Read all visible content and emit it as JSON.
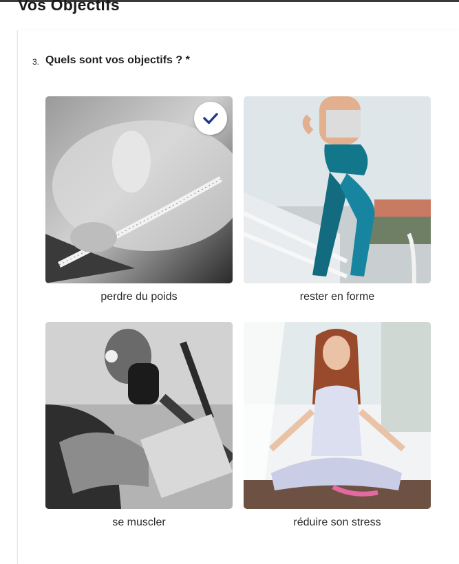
{
  "page": {
    "title": "Vos Objectifs"
  },
  "question": {
    "number": "3.",
    "text": "Quels sont vos objectifs ? *"
  },
  "choices": [
    {
      "label": "perdre du poids",
      "image": "tape-measure-waist-photo",
      "selected": true
    },
    {
      "label": "rester en forme",
      "image": "woman-running-stairs-photo",
      "selected": false
    },
    {
      "label": "se muscler",
      "image": "man-training-gym-photo",
      "selected": false
    },
    {
      "label": "réduire son stress",
      "image": "woman-meditating-photo",
      "selected": false
    }
  ],
  "colors": {
    "accent": "#1e3a8a",
    "text": "#1f1f1f"
  },
  "icons": {
    "selected": "checkmark-icon"
  }
}
